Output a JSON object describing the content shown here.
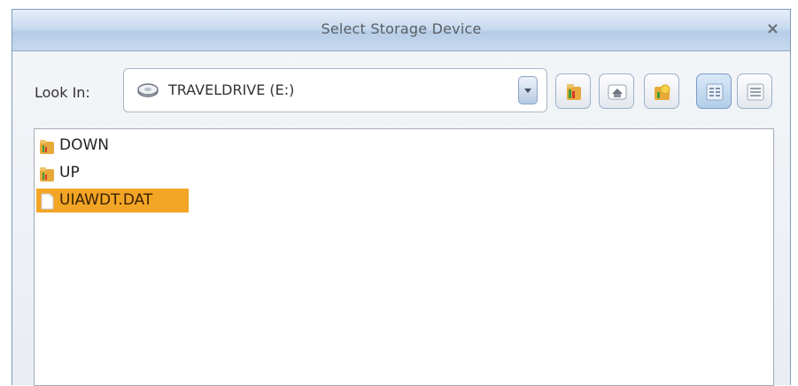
{
  "dialog": {
    "title": "Select Storage Device",
    "close_symbol": "×"
  },
  "lookin": {
    "label": "Look In:",
    "drive_icon": "drive-icon",
    "value": "TRAVELDRIVE (E:)"
  },
  "toolbar": {
    "buttons": [
      {
        "name": "up-folder-icon",
        "active": false
      },
      {
        "name": "home-icon",
        "active": false
      },
      {
        "name": "new-folder-icon",
        "active": false
      },
      {
        "name": "list-view-icon",
        "active": true
      },
      {
        "name": "details-view-icon",
        "active": false
      }
    ]
  },
  "files": [
    {
      "name": "DOWN",
      "type": "folder",
      "selected": false
    },
    {
      "name": "UP",
      "type": "folder",
      "selected": false
    },
    {
      "name": "UIAWDT.DAT",
      "type": "file",
      "selected": true
    }
  ],
  "colors": {
    "selection": "#f3a526",
    "title_bar": "#c8daef",
    "folder": "#e8a93b"
  }
}
